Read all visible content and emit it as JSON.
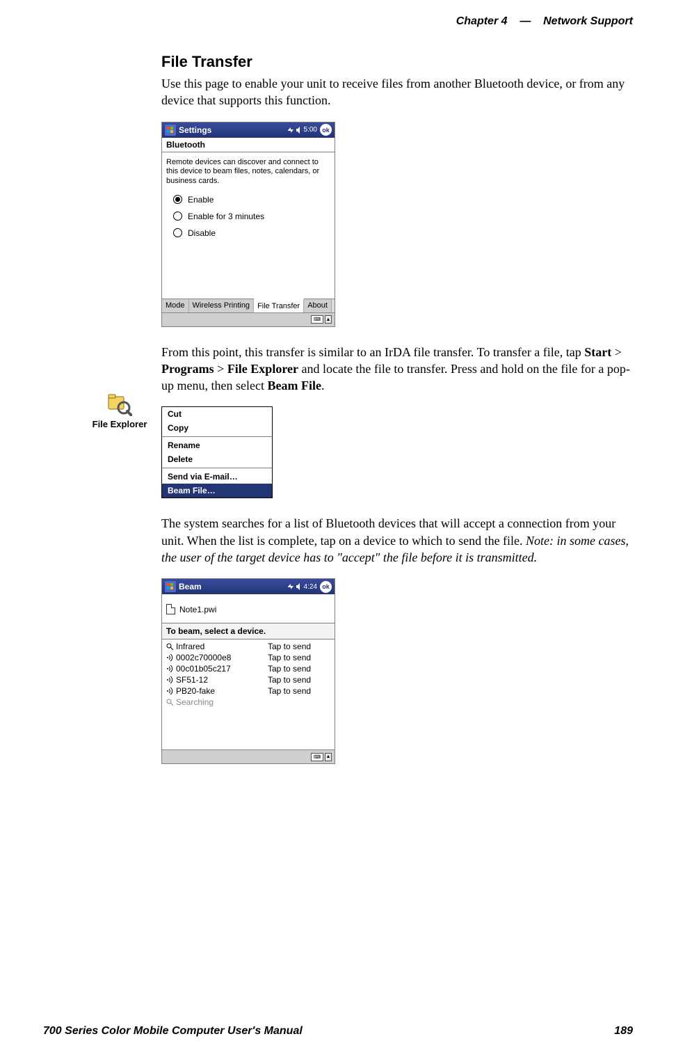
{
  "header": {
    "chapter": "Chapter  4",
    "sep": "—",
    "title": "Network Support"
  },
  "section": {
    "title": "File Transfer"
  },
  "para1": "Use this page to enable your unit to receive files from another Bluetooth device, or from any device that supports this function.",
  "device1": {
    "titlebar": {
      "title": "Settings",
      "time": "5:00",
      "ok": "ok"
    },
    "subhead": "Bluetooth",
    "desc": "Remote devices can discover and connect to this device to beam files, notes, calendars, or business cards.",
    "radios": [
      {
        "label": "Enable",
        "selected": true
      },
      {
        "label": "Enable for 3 minutes",
        "selected": false
      },
      {
        "label": "Disable",
        "selected": false
      }
    ],
    "tabs": [
      "Mode",
      "Wireless Printing",
      "File Transfer",
      "About"
    ],
    "active_tab": 2
  },
  "side_icon": {
    "label": "File Explorer"
  },
  "para2": {
    "pre": "From this point, this transfer is similar to an IrDA file transfer. To transfer a file, tap ",
    "b1": "Start",
    "s1": " > ",
    "b2": "Programs",
    "s2": " > ",
    "b3": "File Explorer",
    "mid": " and locate the file to transfer. Press and hold on the file for a pop-up menu, then select ",
    "b4": "Beam File",
    "end": "."
  },
  "ctx_menu": {
    "items": [
      "Cut",
      "Copy",
      "Rename",
      "Delete",
      "Send via E-mail…",
      "Beam File…"
    ],
    "selected": 5
  },
  "para3": {
    "text": "The system searches for a list of Bluetooth devices that will accept a connection from your unit. When the list is complete, tap on a device to which to send the file. ",
    "note": "Note: in some cases, the user of the target device has to \"accept\" the file before it is transmitted."
  },
  "device2": {
    "titlebar": {
      "title": "Beam",
      "time": "4:24",
      "ok": "ok"
    },
    "file": "Note1.pwi",
    "list_header": "To beam, select a device.",
    "rows": [
      {
        "icon": "mag",
        "name": "Infrared",
        "action": "Tap to send"
      },
      {
        "icon": "sig",
        "name": "0002c70000e8",
        "action": "Tap to send"
      },
      {
        "icon": "sig",
        "name": "00c01b05c217",
        "action": "Tap to send"
      },
      {
        "icon": "sig",
        "name": "SF51-12",
        "action": "Tap to send"
      },
      {
        "icon": "sig",
        "name": "PB20-fake",
        "action": "Tap to send"
      },
      {
        "icon": "mag",
        "name": "Searching",
        "action": "",
        "dim": true
      }
    ]
  },
  "footer": {
    "left": "700 Series Color Mobile Computer User's Manual",
    "right": "189"
  }
}
